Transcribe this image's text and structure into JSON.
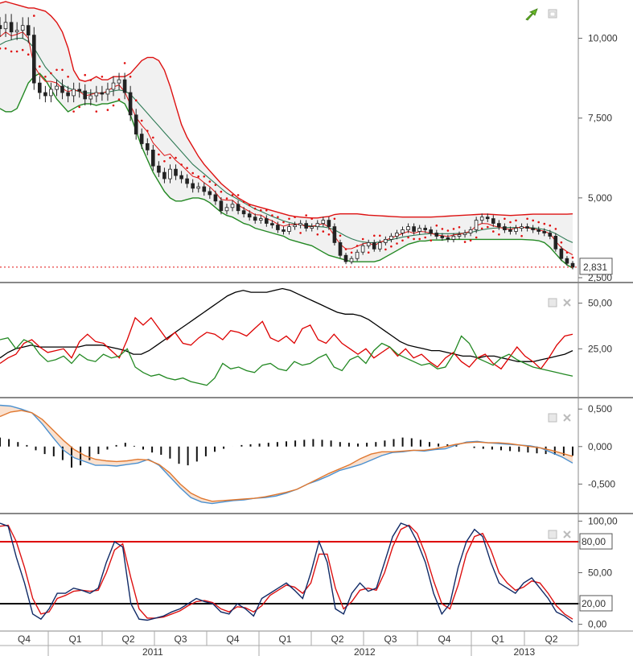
{
  "chart_data": [
    {
      "type": "line",
      "name": "price-panel",
      "description_visible": "Weekly candlestick price with bollinger bands and parabolic SAR dots",
      "ylim": [
        2500,
        11200
      ],
      "y_ticks": [
        "10,000",
        "7,500",
        "5,000",
        "2,500"
      ],
      "y_tick_values": [
        10000,
        7500,
        5000,
        2500
      ],
      "last_value_label": "2,831",
      "last_value": 2831,
      "close": [
        10300,
        10500,
        10200,
        10250,
        10400,
        10100,
        8600,
        8300,
        8200,
        8400,
        8500,
        8300,
        8200,
        8400,
        8350,
        8100,
        8200,
        8300,
        8250,
        8400,
        8600,
        8700,
        8300,
        7600,
        7000,
        6700,
        6500,
        6000,
        5800,
        5600,
        5900,
        5700,
        5600,
        5450,
        5300,
        5350,
        5200,
        5100,
        4900,
        4600,
        4700,
        4800,
        4600,
        4500,
        4400,
        4300,
        4350,
        4200,
        4150,
        4000,
        3950,
        4100,
        4150,
        4200,
        4050,
        4100,
        4200,
        4300,
        4100,
        3600,
        3200,
        3000,
        3100,
        3300,
        3500,
        3600,
        3400,
        3600,
        3700,
        3800,
        3900,
        4000,
        4100,
        3950,
        4050,
        4000,
        3900,
        3800,
        3750,
        3700,
        3800,
        3850,
        3900,
        4000,
        4300,
        4400,
        4350,
        4200,
        4100,
        4000,
        3950,
        4050,
        4100,
        4050,
        4000,
        3950,
        3900,
        3800,
        3400,
        3100,
        2950,
        2831
      ],
      "upper_band": [
        11100,
        11150,
        11100,
        11050,
        11000,
        10950,
        10950,
        10900,
        10850,
        10700,
        10500,
        10200,
        9700,
        9000,
        8700,
        8650,
        8700,
        8800,
        8700,
        8700,
        8800,
        8800,
        8800,
        8900,
        9100,
        9300,
        9400,
        9400,
        9300,
        9000,
        8500,
        7900,
        7300,
        6900,
        6600,
        6300,
        6050,
        5850,
        5650,
        5450,
        5300,
        5150,
        5000,
        4900,
        4800,
        4750,
        4700,
        4650,
        4600,
        4550,
        4500,
        4450,
        4420,
        4400,
        4380,
        4370,
        4370,
        4400,
        4420,
        4480,
        4500,
        4500,
        4500,
        4500,
        4480,
        4460,
        4450,
        4440,
        4430,
        4420,
        4410,
        4400,
        4400,
        4400,
        4400,
        4400,
        4400,
        4410,
        4420,
        4430,
        4440,
        4450,
        4460,
        4470,
        4480,
        4490,
        4490,
        4480,
        4470,
        4460,
        4450,
        4460,
        4470,
        4480,
        4490,
        4490,
        4490,
        4490,
        4490,
        4490,
        4490,
        4500
      ],
      "middle": [
        9800,
        9900,
        9950,
        10000,
        10000,
        9900,
        9700,
        9400,
        9100,
        8900,
        8700,
        8550,
        8450,
        8380,
        8330,
        8300,
        8280,
        8280,
        8290,
        8310,
        8350,
        8380,
        8350,
        8250,
        8050,
        7850,
        7650,
        7450,
        7250,
        7050,
        6850,
        6650,
        6450,
        6250,
        6050,
        5900,
        5750,
        5600,
        5450,
        5300,
        5150,
        5050,
        4950,
        4850,
        4750,
        4650,
        4580,
        4500,
        4420,
        4350,
        4280,
        4230,
        4190,
        4160,
        4140,
        4120,
        4100,
        4090,
        4060,
        4000,
        3900,
        3800,
        3720,
        3660,
        3620,
        3600,
        3600,
        3620,
        3650,
        3690,
        3730,
        3770,
        3800,
        3830,
        3850,
        3870,
        3880,
        3880,
        3880,
        3880,
        3880,
        3890,
        3900,
        3920,
        3960,
        4000,
        4030,
        4050,
        4060,
        4070,
        4070,
        4070,
        4070,
        4070,
        4060,
        4040,
        4010,
        3960,
        3880,
        3780,
        3680,
        3600
      ],
      "lower_band": [
        7800,
        7700,
        7700,
        7800,
        8200,
        8600,
        8800,
        8900,
        8700,
        8400,
        8100,
        7900,
        7700,
        7800,
        7900,
        7950,
        7950,
        7900,
        7950,
        7950,
        8000,
        8050,
        7950,
        7600,
        7100,
        6600,
        6200,
        5800,
        5500,
        5200,
        5000,
        4900,
        4900,
        4950,
        5000,
        5000,
        4950,
        4850,
        4700,
        4550,
        4450,
        4400,
        4300,
        4200,
        4150,
        4050,
        4000,
        3950,
        3900,
        3850,
        3800,
        3700,
        3650,
        3600,
        3550,
        3500,
        3400,
        3300,
        3200,
        3150,
        3100,
        3050,
        3000,
        3000,
        3000,
        3000,
        3000,
        3050,
        3150,
        3250,
        3350,
        3450,
        3550,
        3600,
        3650,
        3650,
        3680,
        3680,
        3680,
        3700,
        3700,
        3700,
        3700,
        3700,
        3700,
        3700,
        3700,
        3700,
        3700,
        3700,
        3700,
        3700,
        3700,
        3690,
        3680,
        3660,
        3600,
        3450,
        3250,
        3050,
        2900,
        2800
      ]
    },
    {
      "type": "line",
      "name": "adx-panel",
      "ylim": [
        0,
        60
      ],
      "y_ticks": [
        "50,00",
        "25,00"
      ],
      "y_tick_values": [
        50,
        25
      ],
      "series": [
        {
          "color": "#000000",
          "values": [
            20,
            23,
            25,
            26,
            27,
            26,
            26,
            26,
            26,
            26,
            26,
            27,
            27,
            27,
            26,
            25,
            24,
            22,
            22,
            24,
            27,
            30,
            33,
            36,
            39,
            42,
            45,
            48,
            51,
            54,
            56,
            57,
            56,
            56,
            56,
            57,
            58,
            57,
            55,
            53,
            51,
            49,
            47,
            45,
            44,
            44,
            43,
            41,
            38,
            35,
            32,
            29,
            27,
            26,
            25,
            24,
            24,
            23,
            22,
            21,
            21,
            20,
            21,
            21,
            20,
            19,
            18,
            18,
            18,
            19,
            20,
            21,
            22,
            24
          ]
        },
        {
          "color": "#dd0000",
          "values": [
            17,
            20,
            22,
            28,
            30,
            26,
            23,
            24,
            25,
            20,
            29,
            33,
            29,
            28,
            24,
            20,
            30,
            42,
            38,
            42,
            36,
            30,
            34,
            28,
            27,
            31,
            34,
            33,
            30,
            35,
            34,
            32,
            36,
            40,
            31,
            29,
            32,
            28,
            36,
            38,
            30,
            28,
            33,
            28,
            25,
            22,
            25,
            20,
            23,
            26,
            21,
            25,
            20,
            22,
            18,
            15,
            20,
            23,
            18,
            15,
            20,
            22,
            17,
            14,
            20,
            26,
            21,
            18,
            14,
            20,
            27,
            32,
            33
          ]
        },
        {
          "color": "#228822",
          "values": [
            30,
            31,
            25,
            30,
            28,
            22,
            18,
            19,
            21,
            17,
            22,
            19,
            18,
            22,
            20,
            21,
            25,
            15,
            12,
            10,
            11,
            9,
            8,
            9,
            7,
            6,
            5,
            9,
            17,
            14,
            15,
            13,
            12,
            16,
            17,
            14,
            13,
            18,
            16,
            17,
            20,
            22,
            15,
            13,
            19,
            21,
            17,
            24,
            28,
            26,
            22,
            20,
            18,
            16,
            17,
            14,
            15,
            22,
            32,
            28,
            20,
            18,
            16,
            20,
            22,
            19,
            17,
            15,
            14,
            13,
            12,
            11,
            10
          ]
        }
      ]
    },
    {
      "type": "area",
      "name": "macd-panel",
      "ylim": [
        -0.85,
        0.62
      ],
      "y_ticks": [
        "0,500",
        "0,000",
        "-0,500"
      ],
      "y_tick_values": [
        0.5,
        0.0,
        -0.5
      ],
      "macd": [
        0.55,
        0.54,
        0.5,
        0.45,
        0.3,
        0.12,
        -0.05,
        -0.15,
        -0.2,
        -0.25,
        -0.25,
        -0.26,
        -0.24,
        -0.22,
        -0.17,
        -0.25,
        -0.4,
        -0.55,
        -0.68,
        -0.74,
        -0.76,
        -0.74,
        -0.72,
        -0.71,
        -0.69,
        -0.68,
        -0.66,
        -0.62,
        -0.57,
        -0.5,
        -0.45,
        -0.39,
        -0.32,
        -0.28,
        -0.24,
        -0.18,
        -0.12,
        -0.08,
        -0.07,
        -0.05,
        -0.06,
        -0.04,
        -0.03,
        0.02,
        0.06,
        0.07,
        0.05,
        0.04,
        0.03,
        0.02,
        0.01,
        -0.02,
        -0.08,
        -0.14,
        -0.22
      ],
      "signal": [
        0.4,
        0.46,
        0.48,
        0.45,
        0.36,
        0.22,
        0.08,
        -0.04,
        -0.12,
        -0.17,
        -0.19,
        -0.2,
        -0.19,
        -0.17,
        -0.18,
        -0.24,
        -0.35,
        -0.5,
        -0.62,
        -0.69,
        -0.73,
        -0.72,
        -0.71,
        -0.7,
        -0.69,
        -0.67,
        -0.64,
        -0.61,
        -0.57,
        -0.5,
        -0.43,
        -0.36,
        -0.3,
        -0.24,
        -0.16,
        -0.1,
        -0.07,
        -0.07,
        -0.06,
        -0.05,
        -0.05,
        -0.03,
        0.0,
        0.03,
        0.05,
        0.06,
        0.05,
        0.05,
        0.04,
        0.02,
        0.0,
        -0.02,
        -0.05,
        -0.09,
        -0.13
      ],
      "histogram": [
        0.12,
        0.1,
        0.06,
        0.02,
        -0.05,
        -0.1,
        -0.13,
        -0.18,
        -0.28,
        -0.25,
        -0.18,
        -0.1,
        -0.04,
        0.02,
        0.05,
        0.01,
        -0.04,
        -0.08,
        -0.11,
        -0.16,
        -0.23,
        -0.25,
        -0.2,
        -0.13,
        -0.07,
        -0.03,
        0.0,
        0.02,
        0.03,
        0.04,
        0.05,
        0.06,
        0.07,
        0.08,
        0.09,
        0.1,
        0.09,
        0.08,
        0.06,
        0.05,
        0.04,
        0.05,
        0.06,
        0.08,
        0.1,
        0.12,
        0.11,
        0.09,
        0.06,
        0.04,
        0.03,
        0.02,
        0.0,
        -0.02,
        -0.03,
        -0.04,
        -0.05,
        -0.06,
        -0.07,
        -0.08,
        -0.09,
        -0.1,
        -0.11,
        -0.12,
        -0.12
      ]
    },
    {
      "type": "line",
      "name": "stochastic-panel",
      "ylim": [
        -5,
        105
      ],
      "y_ticks": [
        "100,00",
        "80,00",
        "50,00",
        "20,00",
        "0,00"
      ],
      "y_tick_values": [
        100,
        80,
        50,
        20,
        0
      ],
      "overbought_label": "80,00",
      "oversold_label": "20,00",
      "k": [
        98,
        95,
        65,
        40,
        10,
        5,
        15,
        30,
        30,
        35,
        33,
        30,
        35,
        60,
        80,
        75,
        20,
        5,
        4,
        6,
        8,
        12,
        15,
        20,
        25,
        22,
        20,
        12,
        10,
        20,
        15,
        8,
        25,
        30,
        35,
        40,
        33,
        25,
        50,
        80,
        60,
        15,
        10,
        30,
        40,
        32,
        35,
        60,
        85,
        98,
        95,
        80,
        60,
        30,
        10,
        20,
        55,
        80,
        92,
        85,
        60,
        40,
        35,
        30,
        40,
        45,
        35,
        25,
        12,
        8,
        2
      ],
      "d": [
        95,
        96,
        80,
        55,
        25,
        10,
        12,
        25,
        28,
        32,
        33,
        32,
        33,
        50,
        72,
        78,
        45,
        15,
        6,
        6,
        7,
        10,
        13,
        18,
        22,
        23,
        21,
        15,
        12,
        17,
        16,
        12,
        18,
        28,
        33,
        38,
        36,
        30,
        40,
        68,
        68,
        35,
        15,
        22,
        33,
        35,
        33,
        50,
        75,
        92,
        96,
        88,
        68,
        42,
        20,
        15,
        38,
        68,
        85,
        88,
        72,
        50,
        40,
        33,
        36,
        42,
        40,
        30,
        18,
        10,
        5
      ]
    }
  ],
  "x_axis": {
    "quarters": [
      "Q4",
      "Q1",
      "Q2",
      "Q3",
      "Q4",
      "Q1",
      "Q2",
      "Q3",
      "Q4",
      "Q1",
      "Q2"
    ],
    "years": [
      "2011",
      "2012",
      "2013"
    ]
  },
  "colors": {
    "upper_band": "#dd1111",
    "lower_band": "#228822",
    "middle": "#2f7a55",
    "sar": "#e01010",
    "band_fill": "#f0f0f0",
    "macd_line": "#4a90d0",
    "signal_line": "#e07830",
    "stoch_k": "#102a66",
    "stoch_d": "#dd1111",
    "level_line_80": "#dd0000",
    "level_line_20": "#000000"
  },
  "icons": [
    "logo-arrow-icon",
    "panel-window-icon",
    "panel-close-icon"
  ]
}
